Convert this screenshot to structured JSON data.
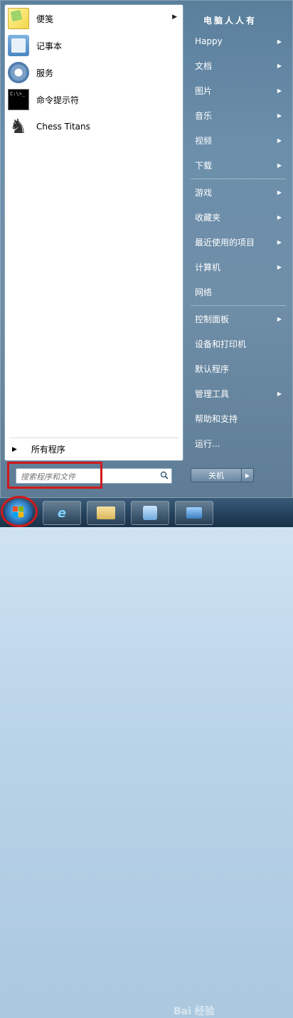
{
  "site_label": "电脑人人有",
  "left_pane": {
    "programs": [
      {
        "label": "便笺",
        "icon": "sticky-notes-icon",
        "has_submenu": true
      },
      {
        "label": "记事本",
        "icon": "notepad-icon",
        "has_submenu": false
      },
      {
        "label": "服务",
        "icon": "services-gear-icon",
        "has_submenu": false
      },
      {
        "label": "命令提示符",
        "icon": "command-prompt-icon",
        "has_submenu": false
      },
      {
        "label": "Chess Titans",
        "icon": "chess-icon",
        "has_submenu": false
      }
    ],
    "all_programs": "所有程序",
    "search_placeholder": "搜索程序和文件"
  },
  "right_pane": {
    "items": [
      {
        "label": "Happy",
        "submenu": true
      },
      {
        "label": "文档",
        "submenu": true
      },
      {
        "label": "图片",
        "submenu": true
      },
      {
        "label": "音乐",
        "submenu": true
      },
      {
        "label": "视频",
        "submenu": true
      },
      {
        "label": "下载",
        "submenu": true
      },
      {
        "label": "游戏",
        "submenu": true
      },
      {
        "label": "收藏夹",
        "submenu": true
      },
      {
        "label": "最近使用的项目",
        "submenu": true
      },
      {
        "label": "计算机",
        "submenu": true
      },
      {
        "label": "网络",
        "submenu": false
      },
      {
        "label": "控制面板",
        "submenu": true
      },
      {
        "label": "设备和打印机",
        "submenu": false
      },
      {
        "label": "默认程序",
        "submenu": false
      },
      {
        "label": "管理工具",
        "submenu": true
      },
      {
        "label": "帮助和支持",
        "submenu": false
      },
      {
        "label": "运行...",
        "submenu": false
      }
    ],
    "shutdown_label": "关机"
  },
  "taskbar": {
    "buttons": [
      "start-orb",
      "internet-explorer-icon",
      "file-explorer-icon",
      "control-panel-icon",
      "network-icon"
    ],
    "watermark": "Bai 经验"
  },
  "colors": {
    "highlight_red": "#d0191c",
    "menu_right_bg": "#6c8fab"
  }
}
